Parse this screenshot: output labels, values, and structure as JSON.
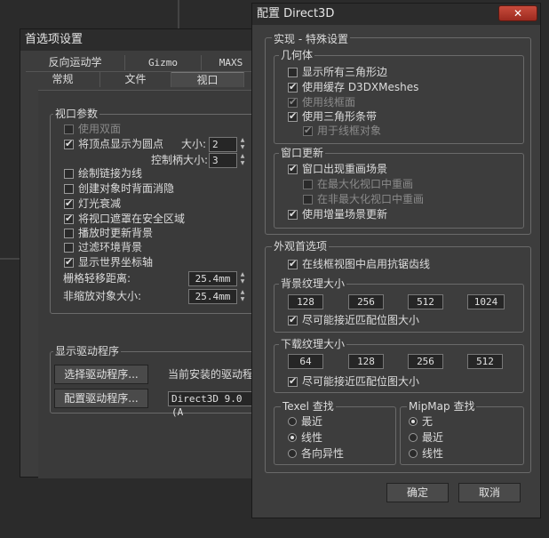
{
  "back_window": {
    "title": "首选项设置",
    "tabs_row1": [
      "反向运动学",
      "Gizmo",
      "MAXS"
    ],
    "tabs_row2": [
      "常规",
      "文件",
      "视口"
    ],
    "viewport_params": {
      "label": "视口参数",
      "items": [
        {
          "label": "使用双面",
          "checked": false,
          "disabled": true
        },
        {
          "label": "将顶点显示为圆点",
          "checked": true,
          "disabled": false
        },
        {
          "label": "绘制链接为线",
          "checked": false,
          "disabled": false
        },
        {
          "label": "创建对象时背面消隐",
          "checked": false,
          "disabled": false
        },
        {
          "label": "灯光衰减",
          "checked": true,
          "disabled": false
        },
        {
          "label": "将视口遮罩在安全区域",
          "checked": true,
          "disabled": false
        },
        {
          "label": "播放时更新背景",
          "checked": false,
          "disabled": false
        },
        {
          "label": "过滤环境背景",
          "checked": false,
          "disabled": false
        },
        {
          "label": "显示世界坐标轴",
          "checked": true,
          "disabled": false
        }
      ],
      "size_label": "大小:",
      "size_value": "2",
      "handle_label": "控制柄大小:",
      "handle_value": "3",
      "grid_nudge_label": "栅格轻移距离:",
      "grid_nudge_value": "25.4mm",
      "non_scale_label": "非缩放对象大小:",
      "non_scale_value": "25.4mm"
    },
    "driver": {
      "label": "显示驱动程序",
      "choose_btn": "选择驱动程序...",
      "installed_label": "当前安装的驱动程",
      "configure_btn": "配置驱动程序...",
      "installed_value": "Direct3D 9.0 (A"
    }
  },
  "front_window": {
    "title": "配置 Direct3D",
    "close": "✕",
    "special": {
      "label": "实现 - 特殊设置",
      "geometry": {
        "label": "几何体",
        "items": [
          {
            "label": "显示所有三角形边",
            "checked": false,
            "disabled": false
          },
          {
            "label": "使用缓存 D3DXMeshes",
            "checked": true,
            "disabled": false
          },
          {
            "label": "使用线框面",
            "checked": true,
            "disabled": true
          },
          {
            "label": "使用三角形条带",
            "checked": true,
            "disabled": false
          },
          {
            "label": "用于线框对象",
            "checked": true,
            "disabled": true
          }
        ]
      },
      "window_update": {
        "label": "窗口更新",
        "items": [
          {
            "label": "窗口出现重画场景",
            "checked": true,
            "disabled": false
          },
          {
            "label": "在最大化视口中重画",
            "checked": false,
            "disabled": true
          },
          {
            "label": "在非最大化视口中重画",
            "checked": false,
            "disabled": true
          },
          {
            "label": "使用增量场景更新",
            "checked": true,
            "disabled": false
          }
        ]
      }
    },
    "appearance": {
      "label": "外观首选项",
      "antialias": {
        "label": "在线框视图中启用抗锯齿线",
        "checked": true
      },
      "bg_texture": {
        "label": "背景纹理大小",
        "options": [
          "128",
          "256",
          "512",
          "1024"
        ],
        "match": {
          "label": "尽可能接近匹配位图大小",
          "checked": true
        }
      },
      "dl_texture": {
        "label": "下载纹理大小",
        "options": [
          "64",
          "128",
          "256",
          "512"
        ],
        "match": {
          "label": "尽可能接近匹配位图大小",
          "checked": true
        }
      },
      "texel": {
        "label": "Texel 查找",
        "options": [
          {
            "label": "最近",
            "selected": false
          },
          {
            "label": "线性",
            "selected": true
          },
          {
            "label": "各向异性",
            "selected": false
          }
        ]
      },
      "mipmap": {
        "label": "MipMap 查找",
        "options": [
          {
            "label": "无",
            "selected": true
          },
          {
            "label": "最近",
            "selected": false
          },
          {
            "label": "线性",
            "selected": false
          }
        ]
      }
    },
    "ok_btn": "确定",
    "cancel_btn": "取消"
  }
}
